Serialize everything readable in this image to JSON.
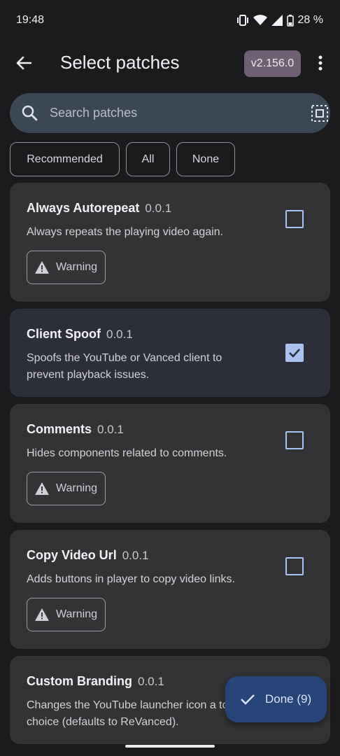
{
  "status_bar": {
    "time": "19:48",
    "battery": "28 %",
    "icons": [
      "vibrate-icon",
      "wifi-icon",
      "signal-icon",
      "battery-icon"
    ]
  },
  "app_bar": {
    "title": "Select patches",
    "version": "v2.156.0",
    "back_icon": "arrow-back-icon",
    "more_icon": "more-vert-icon"
  },
  "search": {
    "placeholder": "Search patches",
    "search_icon": "search-icon",
    "select_all_icon": "select-all-icon"
  },
  "filters": [
    "Recommended",
    "All",
    "None"
  ],
  "patches": [
    {
      "name": "Always Autorepeat",
      "version": "0.0.1",
      "description": "Always repeats the playing video again.",
      "warning": "Warning",
      "checked": false
    },
    {
      "name": "Client Spoof",
      "version": "0.0.1",
      "description": "Spoofs the YouTube or Vanced client to prevent playback issues.",
      "warning": "",
      "checked": true
    },
    {
      "name": "Comments",
      "version": "0.0.1",
      "description": "Hides components related to comments.",
      "warning": "Warning",
      "checked": false
    },
    {
      "name": "Copy Video Url",
      "version": "0.0.1",
      "description": "Adds buttons in player to copy video links.",
      "warning": "Warning",
      "checked": false
    },
    {
      "name": "Custom Branding",
      "version": "0.0.1",
      "description": "Changes the YouTube launcher icon a to your choice (defaults to ReVanced).",
      "warning": "",
      "checked": false
    }
  ],
  "fab": {
    "label": "Done (9)",
    "icon": "check-icon"
  },
  "colors": {
    "accent": "#a9c2f0",
    "fab": "#28457a",
    "version_chip": "#6e6072"
  }
}
